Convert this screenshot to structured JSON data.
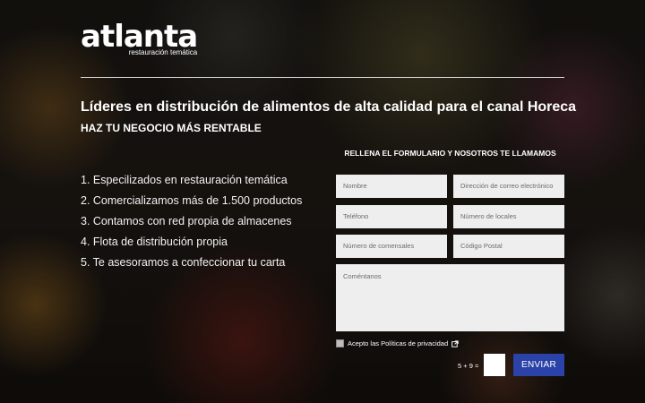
{
  "brand": {
    "name": "atlanta",
    "tagline": "restauración temática"
  },
  "hero": {
    "headline": "Líderes en distribución de alimentos de alta calidad para el canal Horeca",
    "subheadline": "HAZ TU NEGOCIO MÁS RENTABLE"
  },
  "features": [
    "1. Especilizados en restauración temática",
    "2. Comercializamos más de 1.500 productos",
    "3. Contamos con red propia de almacenes",
    "4. Flota de distribución propia",
    "5. Te asesoramos a confeccionar tu carta"
  ],
  "form": {
    "title": "RELLENA EL FORMULARIO Y NOSOTROS TE LLAMAMOS",
    "name_placeholder": "Nombre",
    "email_placeholder": "Dirección de correo electrónico",
    "phone_placeholder": "Teléfono",
    "locations_placeholder": "Número de locales",
    "diners_placeholder": "Número de comensales",
    "zip_placeholder": "Código Postal",
    "comments_placeholder": "Coméntanos",
    "privacy_label": "Acepto las Políticas de privacidad",
    "captcha_question": "5 + 9 =",
    "submit_label": "ENVIAR"
  },
  "colors": {
    "submit_button": "#2b43a8",
    "field_background": "#efeeee"
  }
}
